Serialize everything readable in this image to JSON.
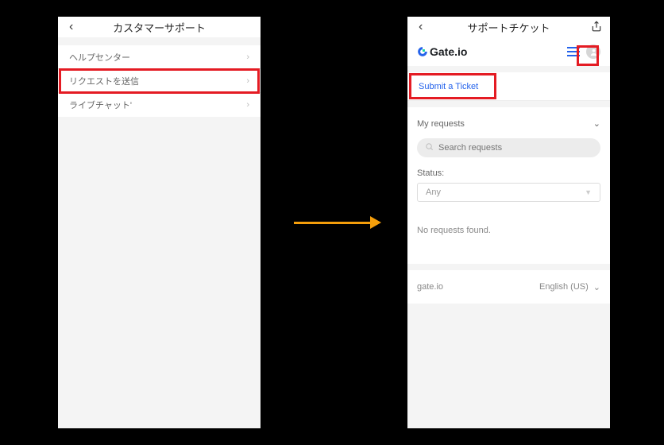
{
  "left": {
    "header_title": "カスタマーサポート",
    "items": [
      {
        "label": "ヘルプセンター"
      },
      {
        "label": "リクエストを送信"
      },
      {
        "label": "ライブチャット'"
      }
    ]
  },
  "right": {
    "header_title": "サポートチケット",
    "brand_name": "Gate.io",
    "submit_label": "Submit a Ticket",
    "my_requests_label": "My requests",
    "search_placeholder": "Search requests",
    "status_label": "Status:",
    "status_value": "Any",
    "no_requests": "No requests found.",
    "footer_site": "gate.io",
    "footer_lang": "English (US)"
  }
}
